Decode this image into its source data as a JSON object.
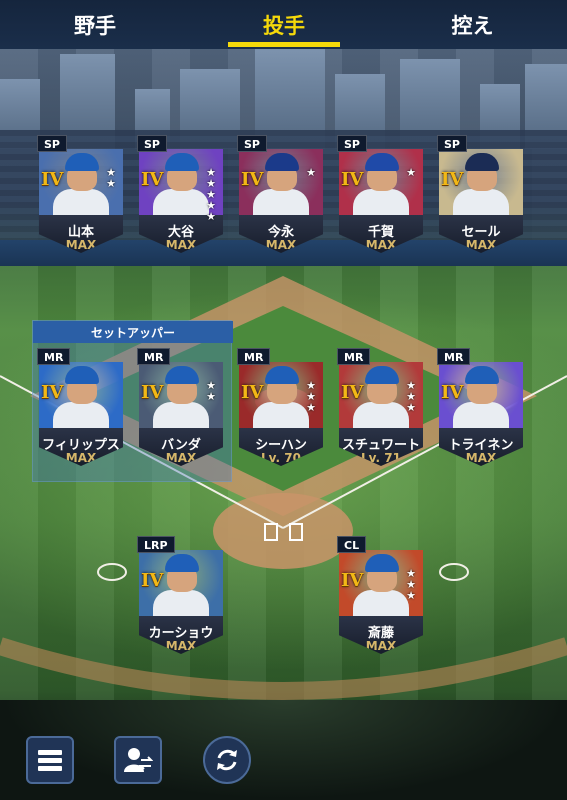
{
  "tabs": [
    {
      "label": "野手",
      "active": false
    },
    {
      "label": "投手",
      "active": true
    },
    {
      "label": "控え",
      "active": false
    }
  ],
  "colors": {
    "accent": "#f5d90a",
    "level_gold": "#d6b76a",
    "rank_gold": "#f2b816",
    "section_blue": "#2b5fa6"
  },
  "starters": [
    {
      "role": "SP",
      "rank": "IV",
      "name": "山本",
      "level": "MAX",
      "stars": "★★",
      "cap": "#1f5fb8",
      "bg": "#4a6fae"
    },
    {
      "role": "SP",
      "rank": "IV",
      "name": "大谷",
      "level": "MAX",
      "stars": "★★★★★",
      "cap": "#1f5fb8",
      "bg": "#6f42c1"
    },
    {
      "role": "SP",
      "rank": "IV",
      "name": "今永",
      "level": "MAX",
      "stars": "★",
      "cap": "#1b3a8a",
      "bg": "#8b2f5c"
    },
    {
      "role": "SP",
      "rank": "IV",
      "name": "千賀",
      "level": "MAX",
      "stars": "★",
      "cap": "#1f4aa8",
      "bg": "#b0304a"
    },
    {
      "role": "SP",
      "rank": "IV",
      "name": "セール",
      "level": "MAX",
      "stars": "",
      "cap": "#1b2c55",
      "bg": "#c8b98f"
    }
  ],
  "setup_section_label": "セットアッパー",
  "middle": [
    {
      "role": "MR",
      "rank": "IV",
      "name": "フィリップス",
      "level": "MAX",
      "stars": "",
      "cap": "#1f5fb8",
      "bg": "#2d6bc7"
    },
    {
      "role": "MR",
      "rank": "IV",
      "name": "バンダ",
      "level": "MAX",
      "stars": "★★",
      "cap": "#1f5fb8",
      "bg": "#4b5b75"
    },
    {
      "role": "MR",
      "rank": "IV",
      "name": "シーハン",
      "level": "Lv. 70",
      "stars": "★★★",
      "cap": "#1f5fb8",
      "bg": "#9a2a2a"
    },
    {
      "role": "MR",
      "rank": "IV",
      "name": "スチュワート",
      "level": "Lv. 71",
      "stars": "★★★",
      "cap": "#1f5fb8",
      "bg": "#b23a3a"
    },
    {
      "role": "MR",
      "rank": "IV",
      "name": "トライネン",
      "level": "MAX",
      "stars": "",
      "cap": "#1f5fb8",
      "bg": "#6a4fd0"
    }
  ],
  "relief": [
    {
      "role": "LRP",
      "rank": "IV",
      "name": "カーショウ",
      "level": "MAX",
      "stars": "",
      "cap": "#1f5fb8",
      "bg": "#3d6fa8"
    },
    {
      "role": "CL",
      "rank": "IV",
      "name": "斎藤",
      "level": "MAX",
      "stars": "★★★",
      "cap": "#1f5fb8",
      "bg": "#c24a2a"
    }
  ],
  "bottom_buttons": [
    {
      "name": "menu-button",
      "icon": "menu-icon"
    },
    {
      "name": "swap-player-button",
      "icon": "person-swap-icon"
    },
    {
      "name": "refresh-button",
      "icon": "refresh-icon"
    }
  ]
}
